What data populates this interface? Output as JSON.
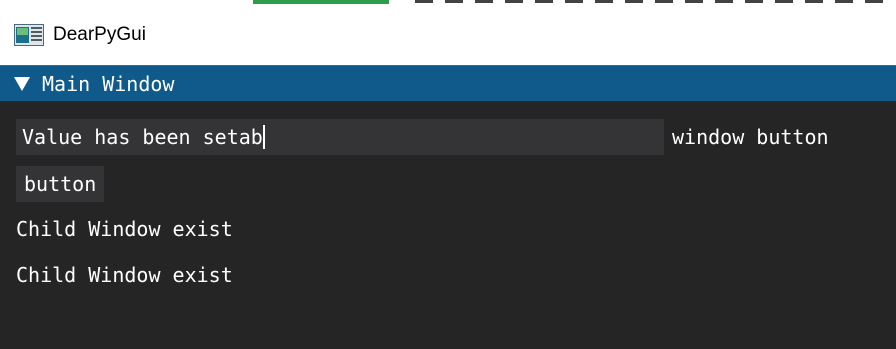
{
  "os_window": {
    "title": "DearPyGui",
    "icon": "dearpygui-app-icon"
  },
  "main_window": {
    "title": "Main Window",
    "collapse_icon": "triangle-down-icon",
    "input_text": {
      "value": "Value has been setab",
      "label": "window button"
    },
    "button": {
      "label": "button"
    },
    "texts": [
      "Child Window exist",
      "Child Window exist"
    ]
  },
  "colors": {
    "titlebar_accent": "#0f5a8a",
    "window_bg": "#252526",
    "widget_bg": "#343436",
    "text": "#ffffff"
  }
}
